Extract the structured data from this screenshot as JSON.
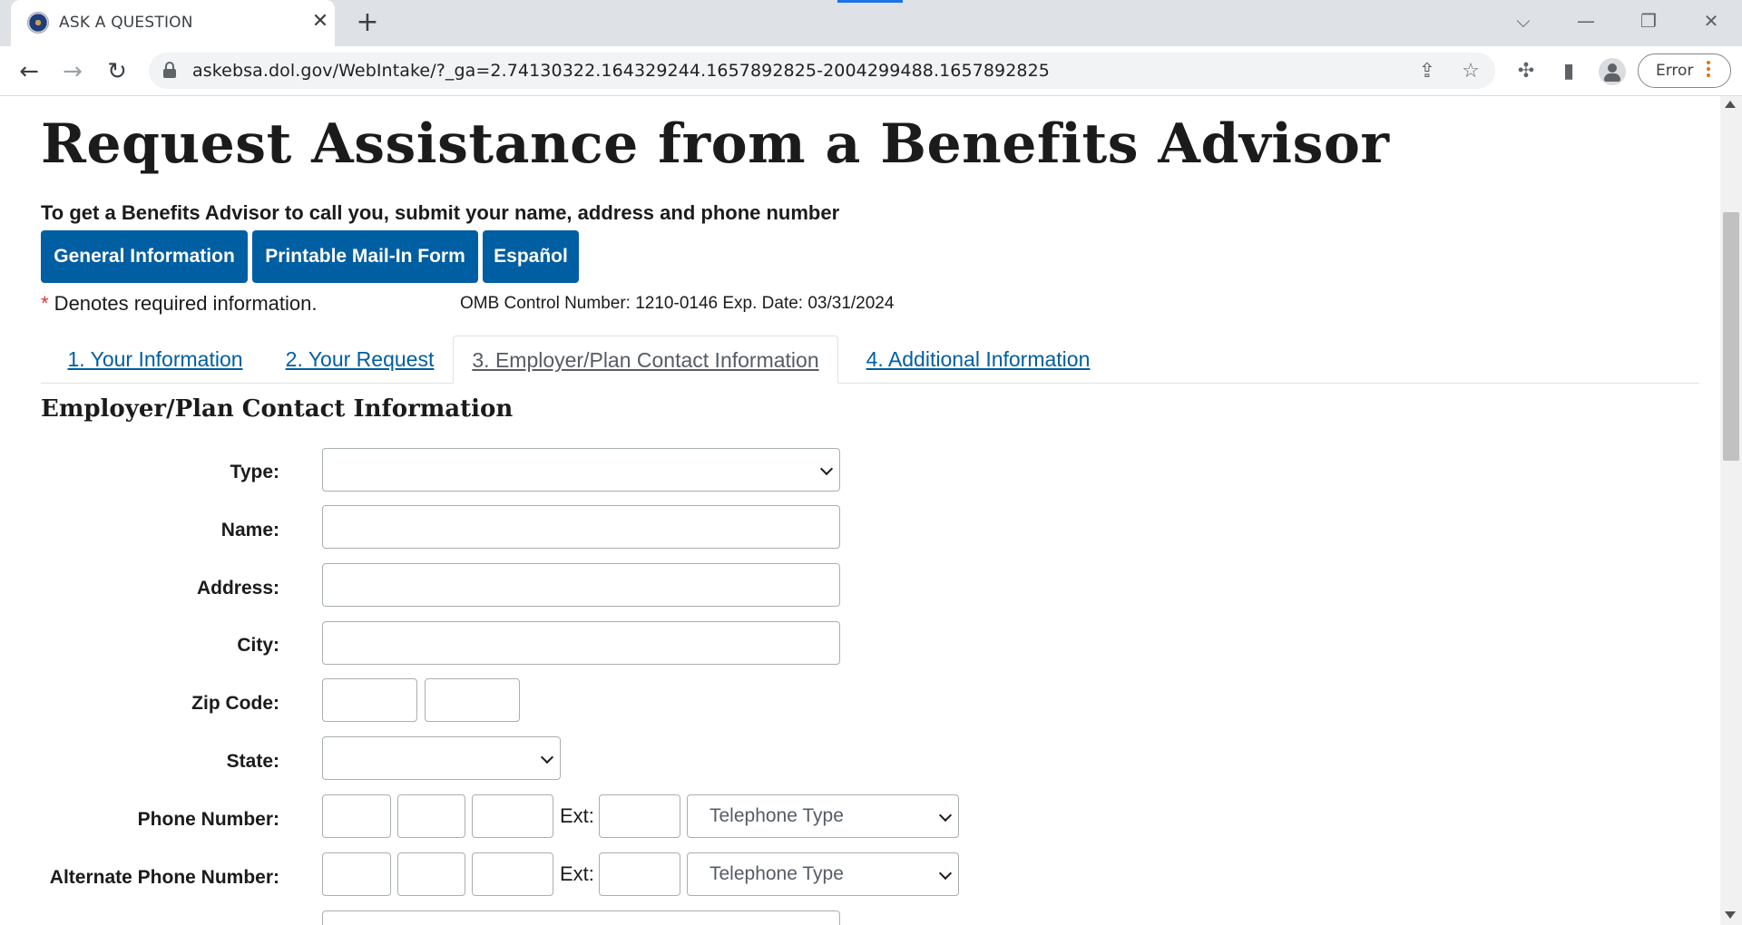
{
  "browser": {
    "tab_title": "ASK A QUESTION",
    "url": "askebsa.dol.gov/WebIntake/?_ga=2.74130322.164329244.1657892825-2004299488.1657892825",
    "error_label": "Error"
  },
  "page": {
    "title": "Request Assistance from a Benefits Advisor",
    "subheading": "To get a Benefits Advisor to call you, submit your name, address and phone number",
    "buttons": {
      "general_info": "General Information",
      "mail_in_form": "Printable Mail-In Form",
      "espanol": "Español"
    },
    "required_star": "*",
    "required_note": " Denotes required information.",
    "omb_note": "OMB Control Number: 1210-0146 Exp. Date: 03/31/2024",
    "tabs": [
      {
        "label": "1. Your Information"
      },
      {
        "label": "2. Your Request"
      },
      {
        "label": "3. Employer/Plan Contact Information"
      },
      {
        "label": "4. Additional Information"
      }
    ],
    "active_tab_index": 2,
    "section_title": "Employer/Plan Contact Information",
    "form": {
      "type_label": "Type:",
      "type_value": "",
      "name_label": "Name:",
      "name_value": "",
      "address_label": "Address:",
      "address_value": "",
      "city_label": "City:",
      "city_value": "",
      "zip_label": "Zip Code:",
      "zip_value": "",
      "zip_ext_value": "",
      "state_label": "State:",
      "state_value": "",
      "phone_label": "Phone Number:",
      "alt_phone_label": "Alternate Phone Number:",
      "ext_label": "Ext:",
      "telephone_type_placeholder": "Telephone Type"
    }
  },
  "colors": {
    "primary_blue": "#005ea2",
    "required_red": "#d83933",
    "chrome_tabstrip": "#dee1e6"
  }
}
